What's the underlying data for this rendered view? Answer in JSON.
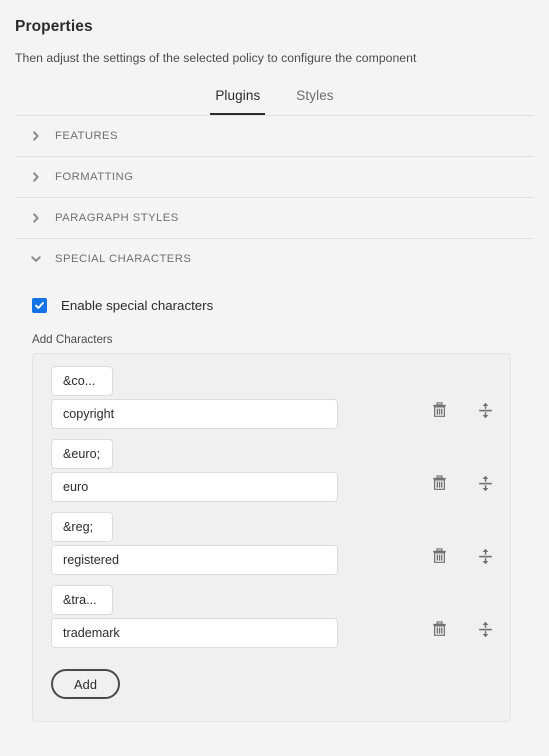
{
  "header": {
    "title": "Properties",
    "description": "Then adjust the settings of the selected policy to configure the component"
  },
  "tabs": [
    {
      "label": "Plugins",
      "active": true
    },
    {
      "label": "Styles",
      "active": false
    }
  ],
  "accordion": [
    {
      "label": "FEATURES",
      "expanded": false,
      "icon": "chevron-right-icon"
    },
    {
      "label": "FORMATTING",
      "expanded": false,
      "icon": "chevron-right-icon"
    },
    {
      "label": "PARAGRAPH STYLES",
      "expanded": false,
      "icon": "chevron-right-icon"
    },
    {
      "label": "SPECIAL CHARACTERS",
      "expanded": true,
      "icon": "chevron-down-icon"
    }
  ],
  "special_characters": {
    "enable_checkbox": {
      "label": "Enable special characters",
      "checked": true,
      "color": "#1473e6"
    },
    "field_label": "Add Characters",
    "row_icons": {
      "delete": "trash-icon",
      "reorder": "drag-handle-icon"
    },
    "entries": [
      {
        "entity": "&co...",
        "name": "copyright"
      },
      {
        "entity": "&euro;",
        "name": "euro"
      },
      {
        "entity": "&reg;",
        "name": "registered"
      },
      {
        "entity": "&tra...",
        "name": "trademark"
      }
    ],
    "add_button": "Add"
  },
  "colors": {
    "background": "#f4f4f4",
    "accent": "#1473e6",
    "text": "#2c2c2c",
    "muted": "#707070",
    "border": "#e1e1e1"
  }
}
